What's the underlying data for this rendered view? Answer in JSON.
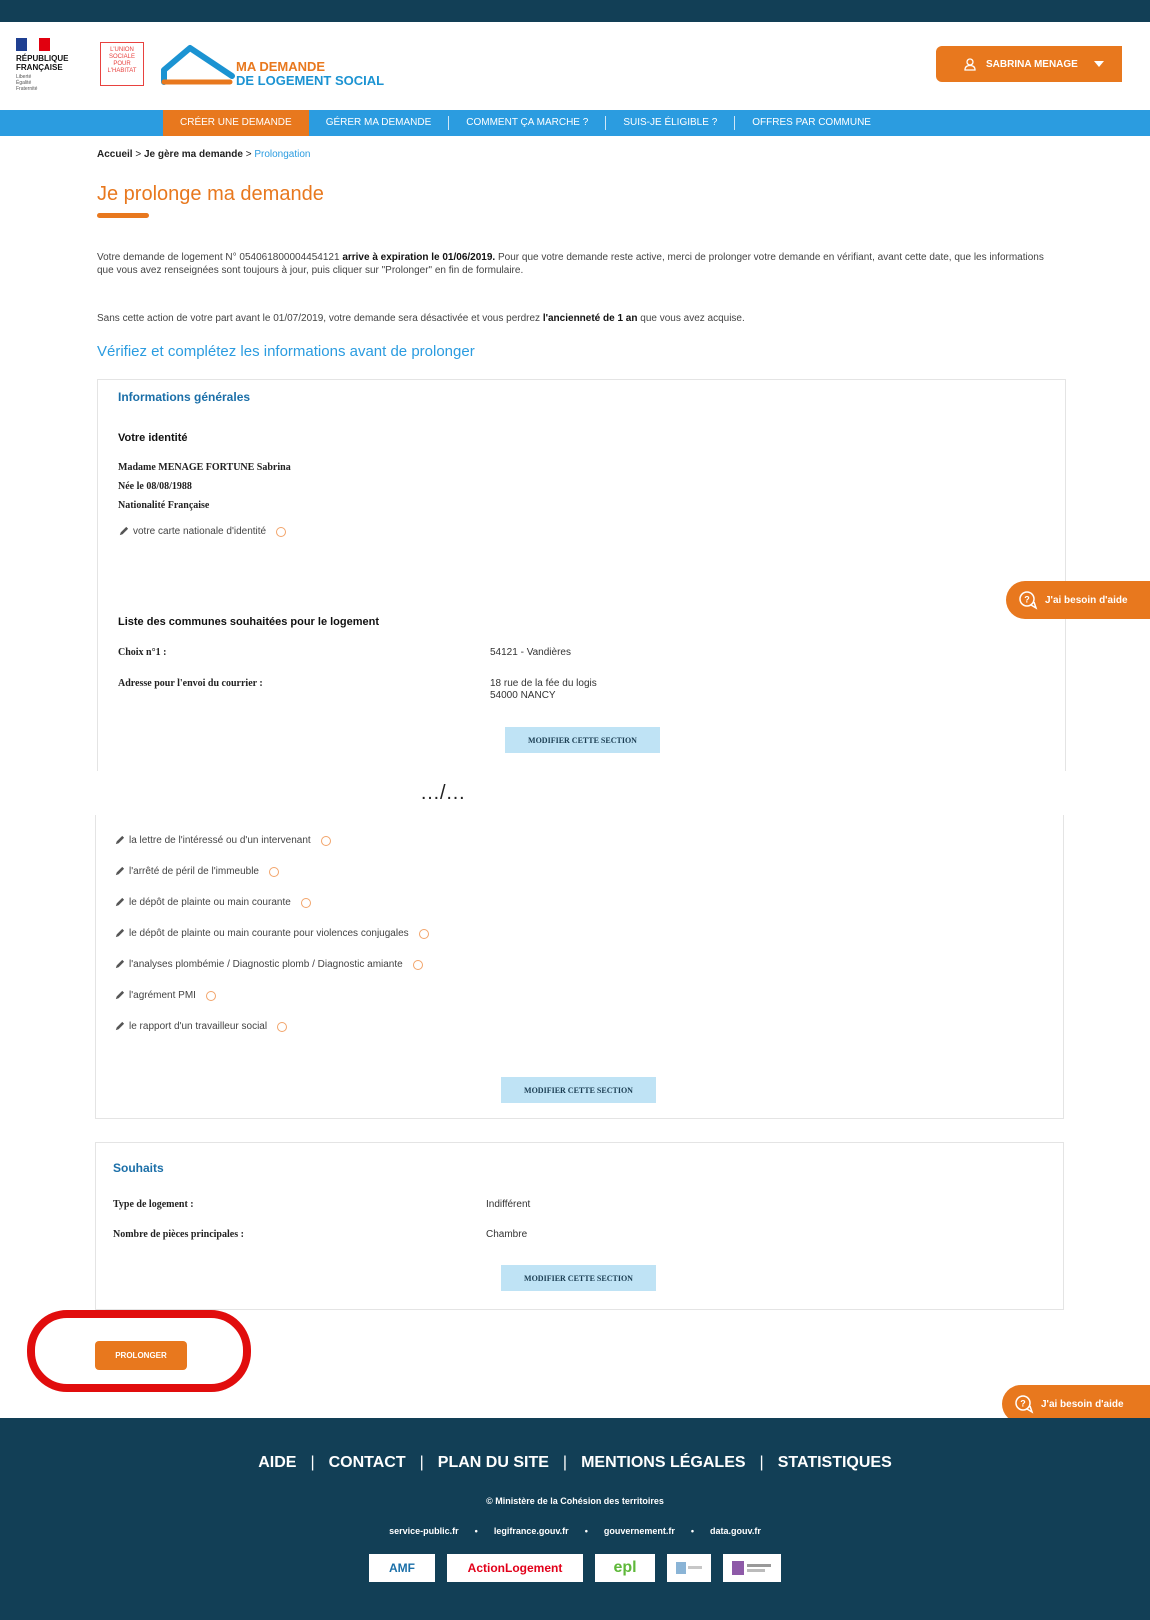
{
  "header": {
    "republique": [
      "RÉPUBLIQUE",
      "FRANÇAISE"
    ],
    "motto": [
      "Liberté",
      "Égalité",
      "Fraternité"
    ],
    "ush": [
      "L'UNION",
      "SOCIALE",
      "POUR",
      "L'HABITAT"
    ],
    "brand_line1": "MA DEMANDE",
    "brand_line2": "DE LOGEMENT SOCIAL",
    "user_name": "SABRINA MENAGE"
  },
  "nav": [
    "CRÉER UNE DEMANDE",
    "GÉRER MA DEMANDE",
    "COMMENT ÇA MARCHE ?",
    "SUIS-JE ÉLIGIBLE ?",
    "OFFRES PAR COMMUNE"
  ],
  "breadcrumb": {
    "home": "Accueil",
    "sep1": " > ",
    "manage": "Je gère ma demande",
    "sep2": " > ",
    "current": "Prolongation"
  },
  "page_title": "Je prolonge ma demande",
  "intro": {
    "p1_a": "Votre demande de logement N° 054061800004454121 ",
    "p1_b": "arrive à expiration le 01/06/2019.",
    "p1_c": " Pour que votre demande reste active, merci de prolonger votre demande en vérifiant, avant cette date, que les informations que vous avez renseignées sont toujours à jour, puis cliquer sur \"Prolonger\" en fin de formulaire.",
    "p2_a": "Sans cette action de votre part avant le 01/07/2019, votre demande sera désactivée et vous perdrez ",
    "p2_b": "l'ancienneté de 1 an",
    "p2_c": " que vous avez acquise."
  },
  "section_heading": "Vérifiez et complétez les informations avant de prolonger",
  "general": {
    "title": "Informations générales",
    "identity_title": "Votre identité",
    "name": "Madame MENAGE FORTUNE Sabrina",
    "birth": "Née le 08/08/1988",
    "nationality": "Nationalité Française",
    "id_doc": "votre carte nationale d'identité",
    "communes_title": "Liste des communes souhaitées pour le logement",
    "choice_label": "Choix n°1 :",
    "choice_value": "54121 - Vandières",
    "address_label": "Adresse pour l'envoi du courrier :",
    "address_line1": "18 rue de la fée du logis",
    "address_line2": "54000 NANCY",
    "modify": "MODIFIER CETTE SECTION"
  },
  "ellipsis": "…/…",
  "documents": {
    "items": [
      "la lettre de l'intéressé ou d'un intervenant",
      "l'arrêté de péril de l'immeuble",
      "le dépôt de plainte ou main courante",
      "le dépôt de plainte ou main courante pour violences conjugales",
      "l'analyses plombémie / Diagnostic plomb / Diagnostic amiante",
      "l'agrément PMI",
      "le rapport d'un travailleur social"
    ],
    "modify": "MODIFIER CETTE SECTION"
  },
  "wishes": {
    "title": "Souhaits",
    "type_label": "Type de logement :",
    "type_value": "Indifférent",
    "rooms_label": "Nombre de pièces principales :",
    "rooms_value": "Chambre",
    "modify": "MODIFIER CETTE SECTION"
  },
  "help_label": "J'ai besoin d'aide",
  "prolonger_label": "PROLONGER",
  "footer": {
    "links": [
      "AIDE",
      "CONTACT",
      "PLAN DU SITE",
      "MENTIONS LÉGALES",
      "STATISTIQUES"
    ],
    "copyright": "© Ministère de la Cohésion des territoires",
    "sites": [
      "service-public.fr",
      "legifrance.gouv.fr",
      "gouvernement.fr",
      "data.gouv.fr"
    ],
    "logos": [
      "AMF",
      "ActionLogement",
      "epl"
    ]
  },
  "colors": {
    "orange": "#e8781e",
    "blue": "#2b9ce0",
    "dark": "#123f56",
    "highlight": "#e10d0d"
  }
}
